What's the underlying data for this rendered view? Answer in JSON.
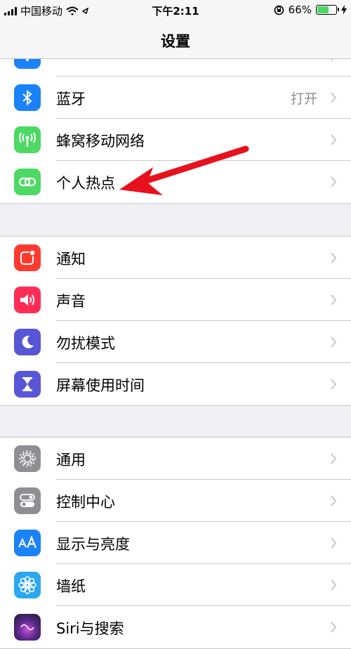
{
  "status": {
    "carrier": "中国移动",
    "time": "下午2:11",
    "battery_text": "66%",
    "battery_level": 0.66
  },
  "nav": {
    "title": "设置"
  },
  "colors": {
    "blue": "#1a82fb",
    "green": "#4cd964",
    "red": "#ff3b30",
    "pink": "#ff2d55",
    "purple": "#5856d6",
    "gray": "#8e8e93",
    "accent_arrow": "#e8101c"
  },
  "group1": {
    "wlan": {
      "label": "",
      "icon": "wifi-icon"
    },
    "bluetooth": {
      "label": "蓝牙",
      "value": "打开",
      "icon": "bluetooth-icon"
    },
    "cellular": {
      "label": "蜂窝移动网络",
      "icon": "antenna-icon"
    },
    "hotspot": {
      "label": "个人热点",
      "icon": "hotspot-link-icon"
    }
  },
  "group2": {
    "notifications": {
      "label": "通知",
      "icon": "notification-icon"
    },
    "sounds": {
      "label": "声音",
      "icon": "speaker-icon"
    },
    "dnd": {
      "label": "勿扰模式",
      "icon": "moon-icon"
    },
    "screentime": {
      "label": "屏幕使用时间",
      "icon": "hourglass-icon"
    }
  },
  "group3": {
    "general": {
      "label": "通用",
      "icon": "gear-icon"
    },
    "control": {
      "label": "控制中心",
      "icon": "toggles-icon"
    },
    "display": {
      "label": "显示与亮度",
      "icon": "text-size-icon"
    },
    "wallpaper": {
      "label": "墙纸",
      "icon": "flower-icon"
    },
    "siri": {
      "label": "Siri与搜索",
      "icon": "siri-icon"
    }
  }
}
